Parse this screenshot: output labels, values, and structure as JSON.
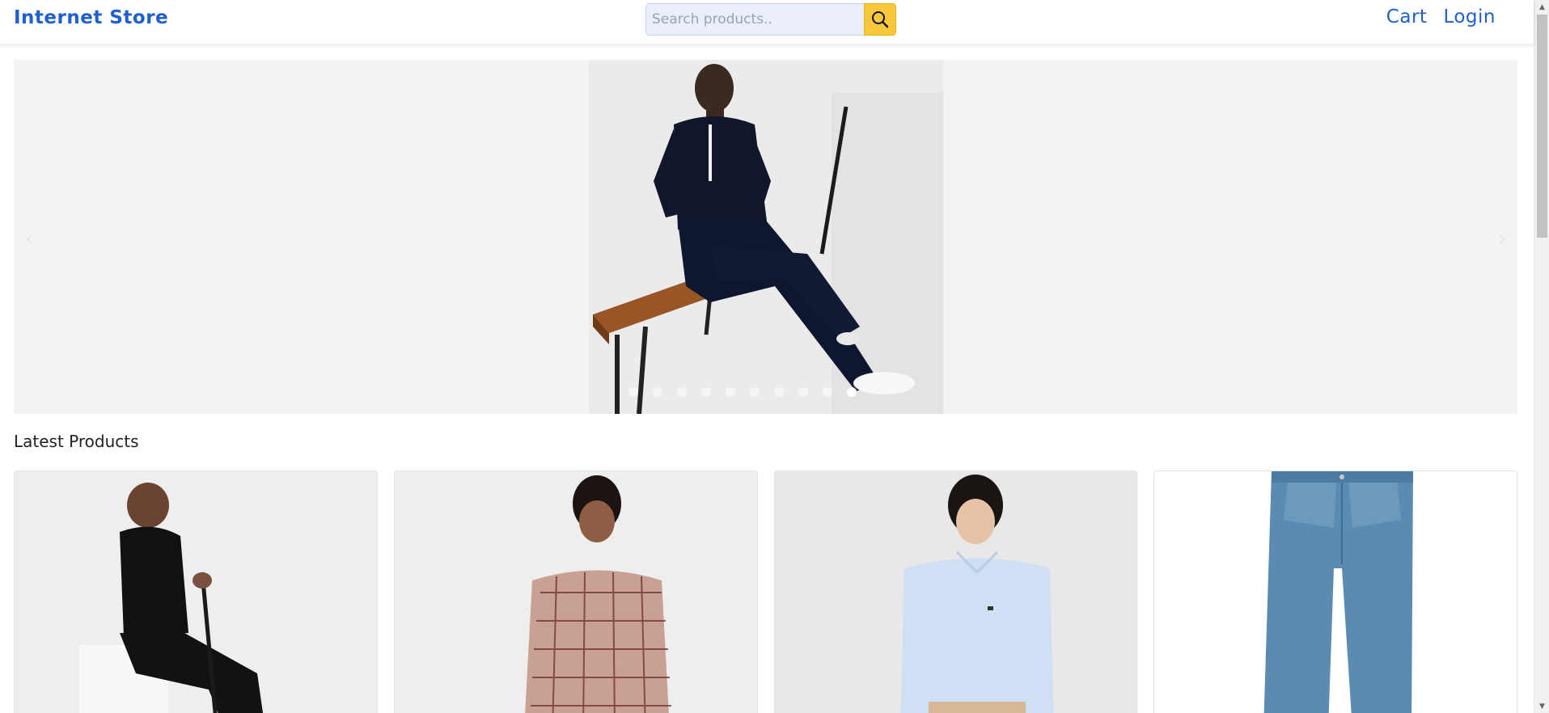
{
  "header": {
    "brand": "Internet Store",
    "search_placeholder": "Search products..",
    "search_icon": "search-icon",
    "nav": [
      {
        "label": "Cart"
      },
      {
        "label": "Login"
      }
    ]
  },
  "carousel": {
    "prev_icon": "chevron-left-icon",
    "next_icon": "chevron-right-icon",
    "slide_count": 10,
    "active_index": 9,
    "background_color": "#f2f3f5"
  },
  "latest": {
    "title": "Latest Products"
  },
  "colors": {
    "brand": "#1f5fd1",
    "search_button": "#f7c93a"
  }
}
